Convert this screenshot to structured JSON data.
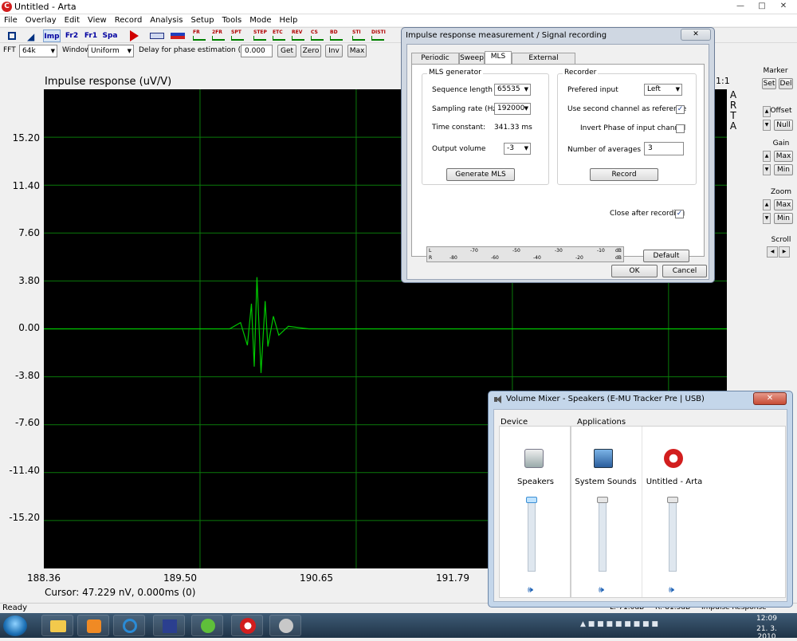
{
  "window": {
    "title": "Untitled - Arta",
    "app_icon": "C"
  },
  "menu": [
    "File",
    "Overlay",
    "Edit",
    "View",
    "Record",
    "Analysis",
    "Setup",
    "Tools",
    "Mode",
    "Help"
  ],
  "toolbar": {
    "text_buttons": [
      "Imp",
      "Fr2",
      "Fr1",
      "Spa"
    ],
    "icon_labels": [
      "FR",
      "2FR",
      "SPT",
      "STEP",
      "ETC",
      "REV",
      "CS",
      "BD",
      "STI",
      "DISTI"
    ]
  },
  "controls": {
    "fft_label": "FFT",
    "fft_value": "64k",
    "window_label": "Window",
    "window_value": "Uniform",
    "delay_label": "Delay for phase estimation (ms)",
    "delay_value": "0.000",
    "get": "Get",
    "zero": "Zero",
    "inv": "Inv",
    "max": "Max"
  },
  "plot": {
    "title": "Impulse response (uV/V)",
    "scale_label": "1:1",
    "brand_letters": [
      "A",
      "R",
      "T",
      "A"
    ],
    "y_ticks": [
      "15.20",
      "11.40",
      "7.60",
      "3.80",
      "0.00",
      "-3.80",
      "-7.60",
      "-11.40",
      "-15.20"
    ],
    "x_ticks": [
      "188.36",
      "189.50",
      "190.65",
      "191.79"
    ],
    "cursor": "Cursor: 47.229 nV, 0.000ms (0)",
    "trace_color": "#00c800"
  },
  "chart_data": {
    "type": "line",
    "title": "Impulse response (uV/V)",
    "xlabel": "",
    "ylabel": "",
    "xlim": [
      188.36,
      193.36
    ],
    "ylim": [
      -19.0,
      19.0
    ],
    "grid": true,
    "series": [
      {
        "x": [
          188.36,
          189.2,
          189.72,
          189.8,
          189.85,
          189.88,
          189.9,
          189.92,
          189.95,
          189.98,
          190.0,
          190.04,
          190.08,
          190.15,
          190.3,
          191.0,
          192.0,
          193.36
        ],
        "y": [
          0.0,
          0.0,
          0.0,
          0.5,
          -1.3,
          2.0,
          -3.0,
          4.1,
          -3.5,
          2.2,
          -1.4,
          1.0,
          -0.5,
          0.2,
          0.0,
          0.0,
          0.0,
          0.0
        ]
      }
    ]
  },
  "right_panel": {
    "marker_label": "Marker",
    "set": "Set",
    "del": "Del",
    "offset_label": "Offset",
    "null": "Null",
    "gain_label": "Gain",
    "zoom_label": "Zoom",
    "max": "Max",
    "min": "Min",
    "scroll_label": "Scroll"
  },
  "status": {
    "ready": "Ready",
    "r1": "L:-71.0dB",
    "r2": "R:-81.5dB",
    "r3": "Impulse Response"
  },
  "dialog": {
    "title": "Impulse response measurement / Signal recording",
    "tabs": [
      "Periodic Noise",
      "Sweep",
      "MLS",
      "External excitation"
    ],
    "active_tab": "MLS",
    "mls": {
      "group_title": "MLS generator",
      "seq_label": "Sequence length",
      "seq_value": "65535",
      "rate_label": "Sampling rate (Hz)",
      "rate_value": "192000",
      "time_label": "Time constant:",
      "time_value": "341.33 ms",
      "vol_label": "Output volume",
      "vol_value": "-3",
      "generate": "Generate MLS"
    },
    "recorder": {
      "group_title": "Recorder",
      "input_label": "Prefered input",
      "input_value": "Left",
      "second_label": "Use second channel as reference",
      "invert_label": "Invert Phase of input channel",
      "avg_label": "Number of averages",
      "avg_value": "3",
      "record": "Record"
    },
    "close_after": "Close after recording",
    "meter": {
      "l_label": "L",
      "r_label": "R",
      "l_ticks": [
        "-70",
        "-50",
        "-30",
        "-10",
        "dB"
      ],
      "r_ticks": [
        "-80",
        "-60",
        "-40",
        "-20",
        "dB"
      ]
    },
    "default": "Default",
    "ok": "OK",
    "cancel": "Cancel"
  },
  "mixer": {
    "title": "Volume Mixer - Speakers (E-MU Tracker Pre | USB)",
    "device_label": "Device",
    "apps_label": "Applications",
    "channels": [
      {
        "name": "Speakers",
        "icon": "speaker-icon",
        "level": 1.0
      },
      {
        "name": "System Sounds",
        "icon": "system-sounds-icon",
        "level": 1.0
      },
      {
        "name": "Untitled - Arta",
        "icon": "arta-icon",
        "level": 1.0
      }
    ]
  },
  "taskbar": {
    "time": "12:09",
    "date": "21. 3. 2010"
  }
}
